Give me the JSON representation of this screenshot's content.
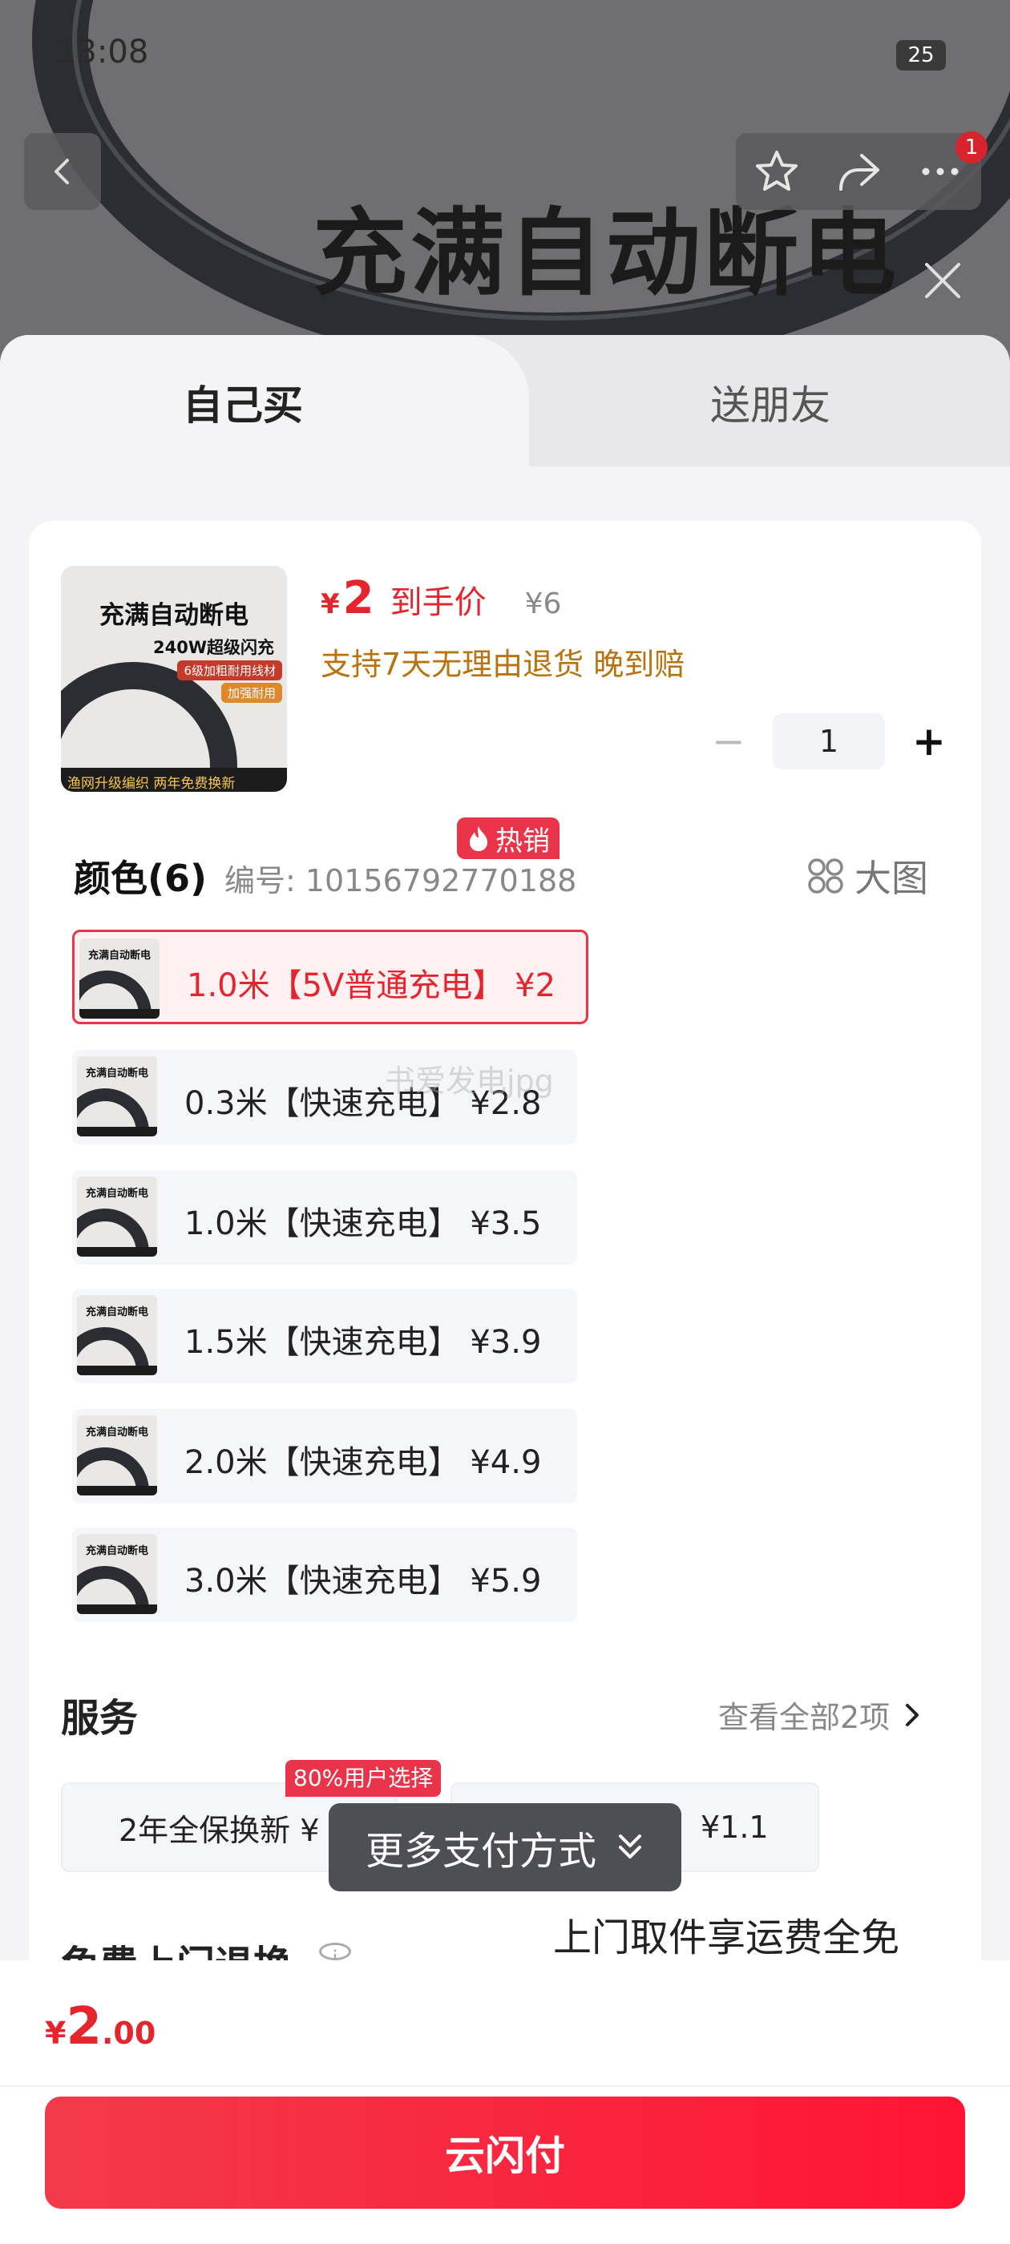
{
  "status_bar": {
    "time": "13:08",
    "battery": "25"
  },
  "top_nav": {
    "badge_count": "1"
  },
  "banner": {
    "headline": "充满自动断电"
  },
  "tabs": [
    {
      "label": "自己买"
    },
    {
      "label": "送朋友"
    }
  ],
  "product": {
    "thumb_title": "充满自动断电",
    "thumb_subtitle": "240W超级闪充",
    "thumb_tag1": "6级加粗耐用线材",
    "thumb_tag2": "加强耐用",
    "thumb_strip": "渔网升级编织 两年免费换新",
    "currency": "¥",
    "price": "2",
    "price_label": "到手价",
    "original_price": "¥6",
    "promise": "支持7天无理由退货 晚到赔",
    "quantity": "1",
    "minus": "−",
    "plus": "+"
  },
  "color_section": {
    "title": "颜色(6)",
    "code": "编号: 10156792770188",
    "big_image": "大图",
    "hot_badge": "热销",
    "options": [
      {
        "label": "1.0米【5V普通充电】 ¥2"
      },
      {
        "label": "0.3米【快速充电】 ¥2.8"
      },
      {
        "label": "1.0米【快速充电】 ¥3.5"
      },
      {
        "label": "1.5米【快速充电】 ¥3.9"
      },
      {
        "label": "2.0米【快速充电】 ¥4.9"
      },
      {
        "label": "3.0米【快速充电】 ¥5.9"
      }
    ],
    "watermark": "书爱发电jpg"
  },
  "service": {
    "title": "服务",
    "view_all": "查看全部2项",
    "badge": "80%用户选择",
    "items": [
      {
        "label": "2年全保换新 ¥"
      },
      {
        "label": "¥1.1"
      }
    ]
  },
  "free_return": {
    "title": "免费上门退换",
    "tip": "上门取件享运费全免"
  },
  "more_payment": {
    "label": "更多支付方式"
  },
  "footer": {
    "currency": "¥",
    "total_int": "2",
    "total_dec": ".00",
    "pay_label": "云闪付"
  },
  "colors": {
    "accent": "#e4252e",
    "pay_button": "#f23a4b",
    "promise": "#b8720e"
  }
}
